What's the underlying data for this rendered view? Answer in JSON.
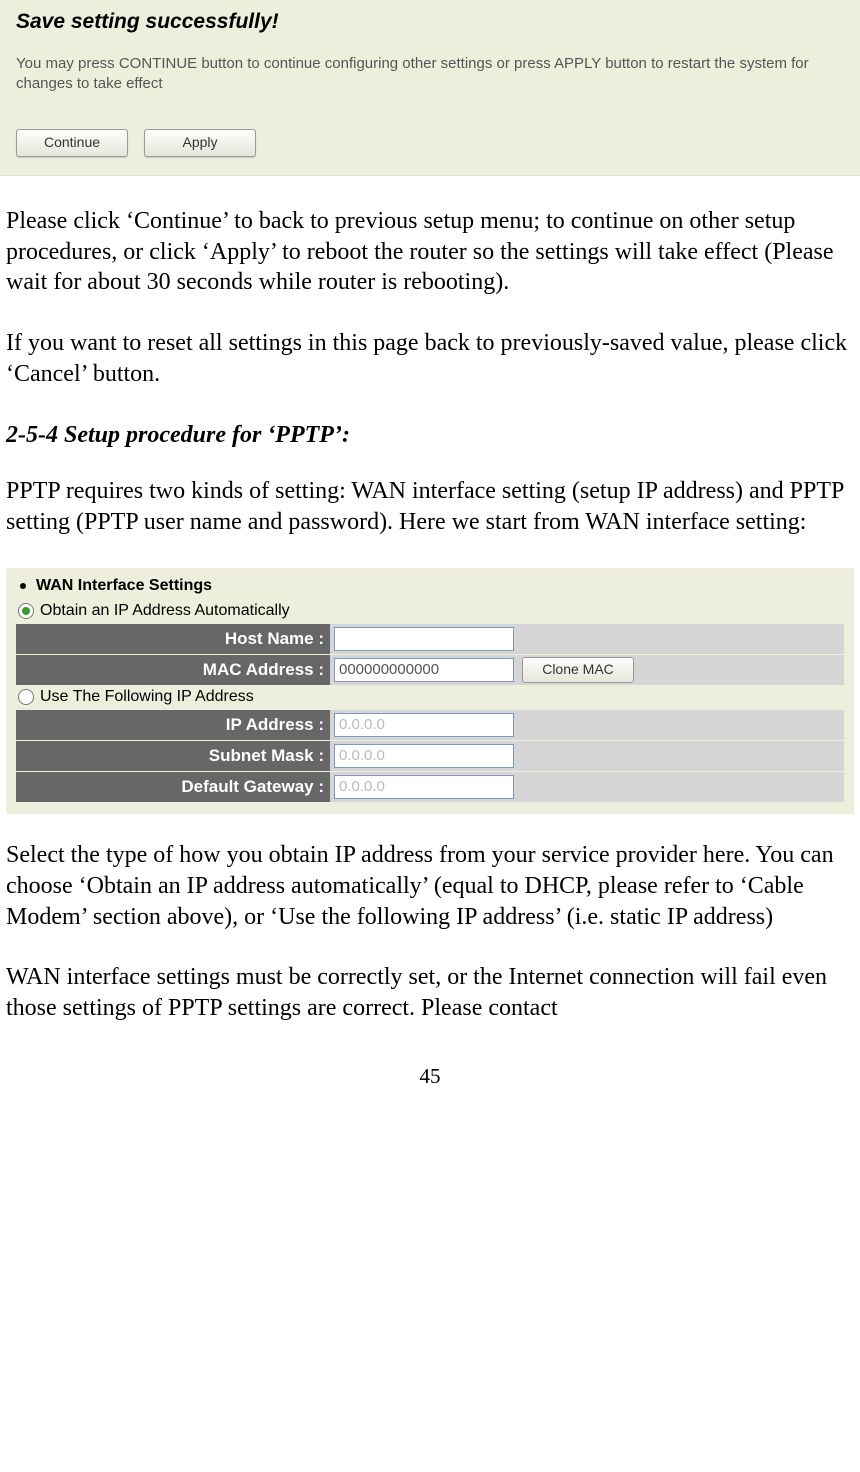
{
  "savePanel": {
    "title": "Save setting successfully!",
    "message": "You may press CONTINUE button to continue configuring other settings or press APPLY button to restart the system for changes to take effect",
    "continueLabel": "Continue",
    "applyLabel": "Apply"
  },
  "body": {
    "para1": "Please click ‘Continue’ to back to previous setup menu; to continue on other setup procedures, or click ‘Apply’ to reboot the router so the settings will take effect (Please wait for about 30 seconds while router is rebooting).",
    "para2": "If you want to reset all settings in this page back to previously-saved value, please click ‘Cancel’ button.",
    "sectionHeading": "2-5-4 Setup procedure for ‘PPTP’:",
    "para3": "PPTP requires two kinds of setting: WAN interface setting (setup IP address) and PPTP setting (PPTP user name and password). Here we start from WAN interface setting:",
    "para4": "Select the type of how you obtain IP address from your service provider here. You can choose ‘Obtain an IP address automatically’ (equal to DHCP, please refer to ‘Cable Modem’ section above), or ‘Use the following IP address’ (i.e. static IP address)",
    "para5": "WAN interface settings must be correctly set, or the Internet connection will fail even those settings of PPTP settings are correct. Please contact"
  },
  "wan": {
    "title": "WAN Interface Settings",
    "radio1": "Obtain an IP Address Automatically",
    "radio2": "Use The Following IP Address",
    "hostNameLabel": "Host Name :",
    "hostNameValue": "",
    "macAddressLabel": "MAC Address :",
    "macAddressValue": "000000000000",
    "cloneLabel": "Clone MAC",
    "ipAddressLabel": "IP Address :",
    "ipAddressValue": "0.0.0.0",
    "subnetMaskLabel": "Subnet Mask :",
    "subnetMaskValue": "0.0.0.0",
    "defaultGatewayLabel": "Default Gateway :",
    "defaultGatewayValue": "0.0.0.0"
  },
  "pageNumber": "45"
}
